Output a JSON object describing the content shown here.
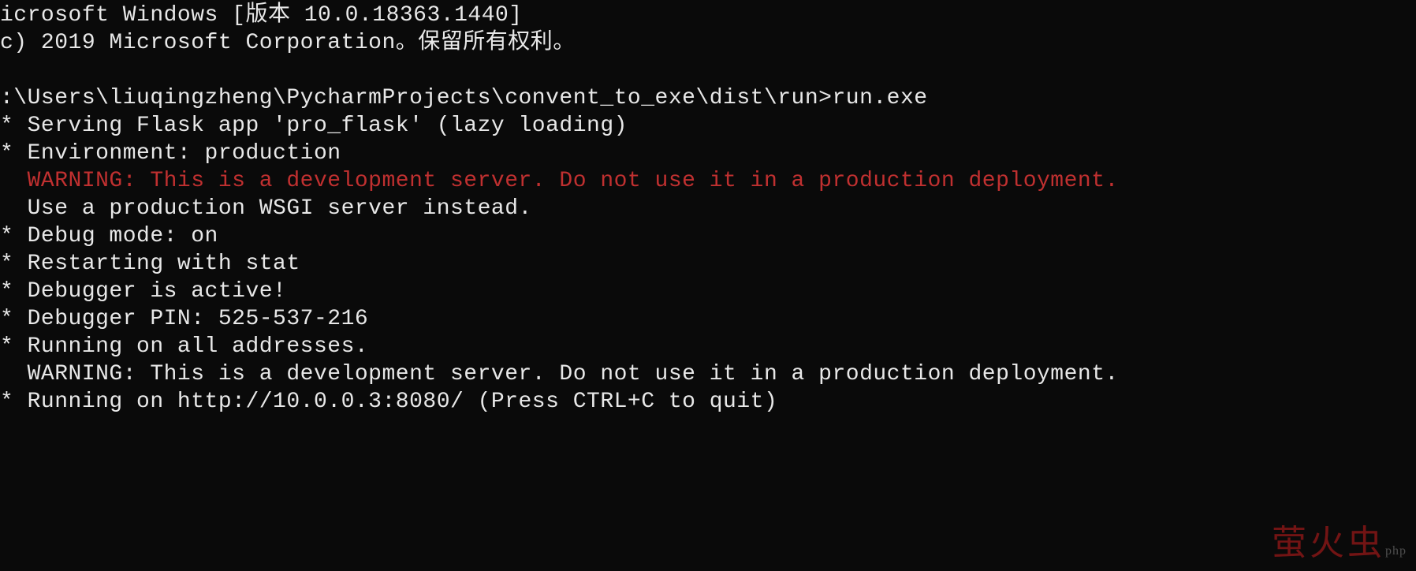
{
  "lines": [
    {
      "text": "icrosoft Windows [版本 10.0.18363.1440]",
      "cls": ""
    },
    {
      "text": "c) 2019 Microsoft Corporation。保留所有权利。",
      "cls": ""
    },
    {
      "text": "",
      "cls": ""
    },
    {
      "text": ":\\Users\\liuqingzheng\\PycharmProjects\\convent_to_exe\\dist\\run>run.exe",
      "cls": ""
    },
    {
      "text": "* Serving Flask app 'pro_flask' (lazy loading)",
      "cls": ""
    },
    {
      "text": "* Environment: production",
      "cls": ""
    },
    {
      "text": "  WARNING: This is a development server. Do not use it in a production deployment.",
      "cls": "red"
    },
    {
      "text": "  Use a production WSGI server instead.",
      "cls": ""
    },
    {
      "text": "* Debug mode: on",
      "cls": ""
    },
    {
      "text": "* Restarting with stat",
      "cls": ""
    },
    {
      "text": "* Debugger is active!",
      "cls": ""
    },
    {
      "text": "* Debugger PIN: 525-537-216",
      "cls": ""
    },
    {
      "text": "* Running on all addresses.",
      "cls": ""
    },
    {
      "text": "  WARNING: This is a development server. Do not use it in a production deployment.",
      "cls": ""
    },
    {
      "text": "* Running on http://10.0.0.3:8080/ (Press CTRL+C to quit)",
      "cls": ""
    }
  ],
  "watermark": {
    "main": "萤火虫",
    "sub": "php"
  }
}
